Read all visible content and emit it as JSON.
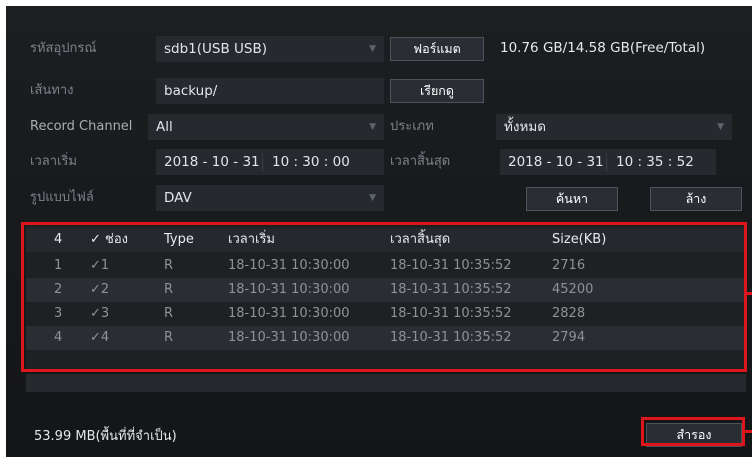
{
  "form": {
    "device_label": "รหัสอุปกรณ์",
    "device_value": "sdb1(USB USB)",
    "format_button": "ฟอร์แมต",
    "capacity": "10.76 GB/14.58 GB(Free/Total)",
    "path_label": "เส้นทาง",
    "path_value": "backup/",
    "browse_button": "เรียกดู",
    "channel_label": "Record Channel",
    "channel_value": "All",
    "type_label": "ประเภท",
    "type_value": "ทั้งหมด",
    "start_label": "เวลาเริ่ม",
    "start_date": "2018 - 10 - 31",
    "start_time": "10 : 30 : 00",
    "end_label": "เวลาสิ้นสุด",
    "end_date": "2018 - 10 - 31",
    "end_time": "10 : 35 : 52",
    "filetype_label": "รูปแบบไฟล์",
    "filetype_value": "DAV",
    "search_button": "ค้นหา",
    "clear_button": "ล้าง"
  },
  "table": {
    "headers": [
      "4",
      "✓ ช่อง",
      "Type",
      "เวลาเริ่ม",
      "เวลาสิ้นสุด",
      "Size(KB)"
    ],
    "rows": [
      [
        "1",
        "✓1",
        "R",
        "18-10-31 10:30:00",
        "18-10-31 10:35:52",
        "2716"
      ],
      [
        "2",
        "✓2",
        "R",
        "18-10-31 10:30:00",
        "18-10-31 10:35:52",
        "45200"
      ],
      [
        "3",
        "✓3",
        "R",
        "18-10-31 10:30:00",
        "18-10-31 10:35:52",
        "2828"
      ],
      [
        "4",
        "✓4",
        "R",
        "18-10-31 10:30:00",
        "18-10-31 10:35:52",
        "2794"
      ]
    ]
  },
  "footer": {
    "required_space": "53.99 MB(พื้นที่ที่จำเป็น)",
    "backup_button": "สำรอง"
  },
  "colors": {
    "highlight": "#e0151b",
    "panel_bg": "#1a1c1f"
  },
  "icons": {
    "dropdown": "chevron-down-icon",
    "check": "checkmark-icon"
  }
}
